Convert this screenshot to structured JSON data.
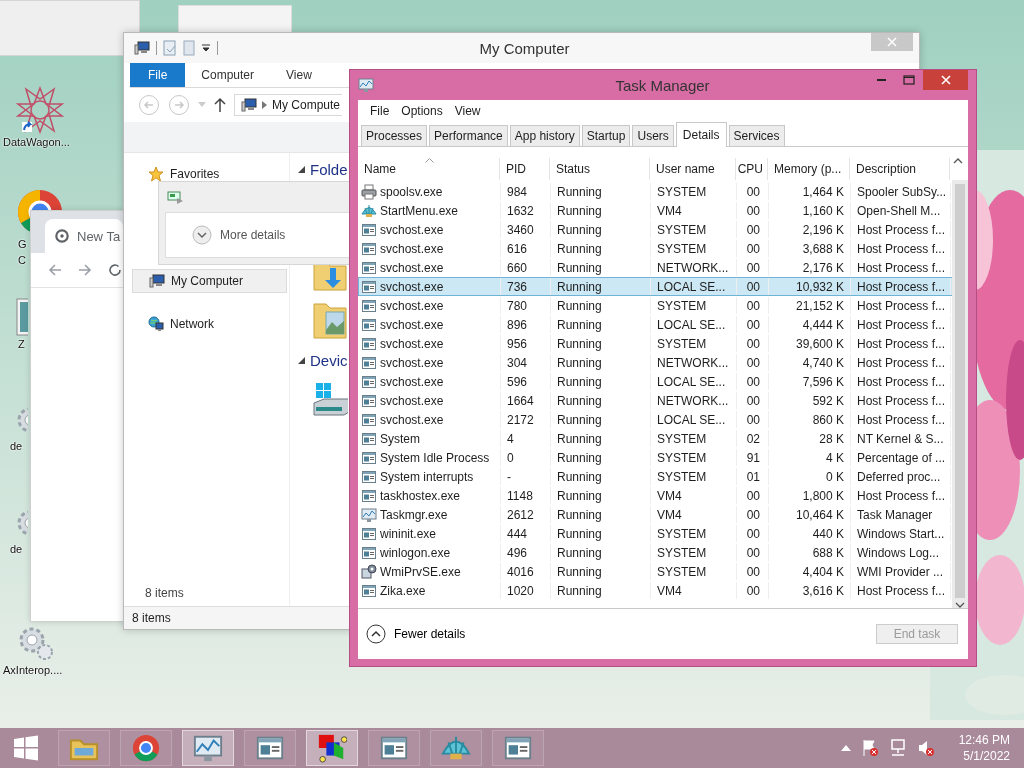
{
  "desktop_icons": [
    {
      "kind": "star-logo",
      "lines": [
        "DataWagon..."
      ]
    },
    {
      "kind": "round-logo",
      "lines": [
        "G",
        "C"
      ]
    },
    {
      "kind": "frame",
      "lines": [
        "Z"
      ]
    },
    {
      "kind": "gear",
      "lines": [
        "de"
      ]
    },
    {
      "kind": "gear",
      "lines": [
        "de"
      ]
    },
    {
      "kind": "gear",
      "lines": [
        "AxInterop...."
      ]
    }
  ],
  "browser": {
    "tab": "New Ta"
  },
  "explorer": {
    "title": "My Computer",
    "ribbon_tabs": [
      {
        "label": "File",
        "selected": true
      },
      {
        "label": "Computer",
        "selected": false
      },
      {
        "label": "View",
        "selected": false
      }
    ],
    "address": "My Compute",
    "nav": [
      {
        "kind": "star",
        "label": "Favorites",
        "selected": false
      },
      {
        "kind": "computer",
        "label": "My Computer",
        "selected": true
      },
      {
        "kind": "network",
        "label": "Network",
        "selected": false
      }
    ],
    "popup": {
      "label": "More details"
    },
    "groups": [
      {
        "label": "Folde",
        "kind": "folders"
      },
      {
        "label": "Devic",
        "kind": "drive"
      }
    ],
    "pane_count": "8 items",
    "status": "8 items"
  },
  "task_manager": {
    "title": "Task Manager",
    "menu": [
      "File",
      "Options",
      "View"
    ],
    "tabs": [
      {
        "label": "Processes",
        "selected": false
      },
      {
        "label": "Performance",
        "selected": false
      },
      {
        "label": "App history",
        "selected": false
      },
      {
        "label": "Startup",
        "selected": false
      },
      {
        "label": "Users",
        "selected": false
      },
      {
        "label": "Details",
        "selected": true
      },
      {
        "label": "Services",
        "selected": false
      }
    ],
    "columns": [
      {
        "label": "Name",
        "sorted": true
      },
      {
        "label": "PID",
        "sorted": false
      },
      {
        "label": "Status",
        "sorted": false
      },
      {
        "label": "User name",
        "sorted": false
      },
      {
        "label": "CPU",
        "sorted": false
      },
      {
        "label": "Memory (p...",
        "sorted": false
      },
      {
        "label": "Description",
        "sorted": false
      }
    ],
    "rows": [
      {
        "kind": "printer",
        "name": "spoolsv.exe",
        "pid": "984",
        "status": "Running",
        "user": "SYSTEM",
        "cpu": "00",
        "memory": "1,464 K",
        "description": "Spooler SubSy...",
        "selected": false
      },
      {
        "kind": "shell",
        "name": "StartMenu.exe",
        "pid": "1632",
        "status": "Running",
        "user": "VM4",
        "cpu": "00",
        "memory": "1,160 K",
        "description": "Open-Shell M...",
        "selected": false
      },
      {
        "kind": "window",
        "name": "svchost.exe",
        "pid": "3460",
        "status": "Running",
        "user": "SYSTEM",
        "cpu": "00",
        "memory": "2,196 K",
        "description": "Host Process f...",
        "selected": false
      },
      {
        "kind": "window",
        "name": "svchost.exe",
        "pid": "616",
        "status": "Running",
        "user": "SYSTEM",
        "cpu": "00",
        "memory": "3,688 K",
        "description": "Host Process f...",
        "selected": false
      },
      {
        "kind": "window",
        "name": "svchost.exe",
        "pid": "660",
        "status": "Running",
        "user": "NETWORK...",
        "cpu": "00",
        "memory": "2,176 K",
        "description": "Host Process f...",
        "selected": false
      },
      {
        "kind": "window",
        "name": "svchost.exe",
        "pid": "736",
        "status": "Running",
        "user": "LOCAL SE...",
        "cpu": "00",
        "memory": "10,932 K",
        "description": "Host Process f...",
        "selected": true
      },
      {
        "kind": "window",
        "name": "svchost.exe",
        "pid": "780",
        "status": "Running",
        "user": "SYSTEM",
        "cpu": "00",
        "memory": "21,152 K",
        "description": "Host Process f...",
        "selected": false
      },
      {
        "kind": "window",
        "name": "svchost.exe",
        "pid": "896",
        "status": "Running",
        "user": "LOCAL SE...",
        "cpu": "00",
        "memory": "4,444 K",
        "description": "Host Process f...",
        "selected": false
      },
      {
        "kind": "window",
        "name": "svchost.exe",
        "pid": "956",
        "status": "Running",
        "user": "SYSTEM",
        "cpu": "00",
        "memory": "39,600 K",
        "description": "Host Process f...",
        "selected": false
      },
      {
        "kind": "window",
        "name": "svchost.exe",
        "pid": "304",
        "status": "Running",
        "user": "NETWORK...",
        "cpu": "00",
        "memory": "4,740 K",
        "description": "Host Process f...",
        "selected": false
      },
      {
        "kind": "window",
        "name": "svchost.exe",
        "pid": "596",
        "status": "Running",
        "user": "LOCAL SE...",
        "cpu": "00",
        "memory": "7,596 K",
        "description": "Host Process f...",
        "selected": false
      },
      {
        "kind": "window",
        "name": "svchost.exe",
        "pid": "1664",
        "status": "Running",
        "user": "NETWORK...",
        "cpu": "00",
        "memory": "592 K",
        "description": "Host Process f...",
        "selected": false
      },
      {
        "kind": "window",
        "name": "svchost.exe",
        "pid": "2172",
        "status": "Running",
        "user": "LOCAL SE...",
        "cpu": "00",
        "memory": "860 K",
        "description": "Host Process f...",
        "selected": false
      },
      {
        "kind": "window",
        "name": "System",
        "pid": "4",
        "status": "Running",
        "user": "SYSTEM",
        "cpu": "02",
        "memory": "28 K",
        "description": "NT Kernel & S...",
        "selected": false
      },
      {
        "kind": "window",
        "name": "System Idle Process",
        "pid": "0",
        "status": "Running",
        "user": "SYSTEM",
        "cpu": "91",
        "memory": "4 K",
        "description": "Percentage of ...",
        "selected": false
      },
      {
        "kind": "window",
        "name": "System interrupts",
        "pid": "-",
        "status": "Running",
        "user": "SYSTEM",
        "cpu": "01",
        "memory": "0 K",
        "description": "Deferred proc...",
        "selected": false
      },
      {
        "kind": "window",
        "name": "taskhostex.exe",
        "pid": "1148",
        "status": "Running",
        "user": "VM4",
        "cpu": "00",
        "memory": "1,800 K",
        "description": "Host Process f...",
        "selected": false
      },
      {
        "kind": "chart",
        "name": "Taskmgr.exe",
        "pid": "2612",
        "status": "Running",
        "user": "VM4",
        "cpu": "00",
        "memory": "10,464 K",
        "description": "Task Manager",
        "selected": false
      },
      {
        "kind": "window",
        "name": "wininit.exe",
        "pid": "444",
        "status": "Running",
        "user": "SYSTEM",
        "cpu": "00",
        "memory": "440 K",
        "description": "Windows Start...",
        "selected": false
      },
      {
        "kind": "window",
        "name": "winlogon.exe",
        "pid": "496",
        "status": "Running",
        "user": "SYSTEM",
        "cpu": "00",
        "memory": "688 K",
        "description": "Windows Log...",
        "selected": false
      },
      {
        "kind": "gear",
        "name": "WmiPrvSE.exe",
        "pid": "4016",
        "status": "Running",
        "user": "SYSTEM",
        "cpu": "00",
        "memory": "4,404 K",
        "description": "WMI Provider ...",
        "selected": false
      },
      {
        "kind": "window",
        "name": "Zika.exe",
        "pid": "1020",
        "status": "Running",
        "user": "VM4",
        "cpu": "00",
        "memory": "3,616 K",
        "description": "Host Process f...",
        "selected": false
      }
    ],
    "fewer_details": "Fewer details",
    "end_task": {
      "label": "End task",
      "disabled": true
    }
  },
  "taskbar": {
    "items": [
      {
        "kind": "folder",
        "active": false
      },
      {
        "kind": "round-logo",
        "active": false
      },
      {
        "kind": "chart",
        "active": true
      },
      {
        "kind": "window",
        "active": false
      },
      {
        "kind": "shapes",
        "active": true
      },
      {
        "kind": "window",
        "active": false
      },
      {
        "kind": "shell",
        "active": false
      },
      {
        "kind": "window",
        "active": false
      }
    ],
    "time": "12:46 PM",
    "date": "5/1/2022"
  }
}
